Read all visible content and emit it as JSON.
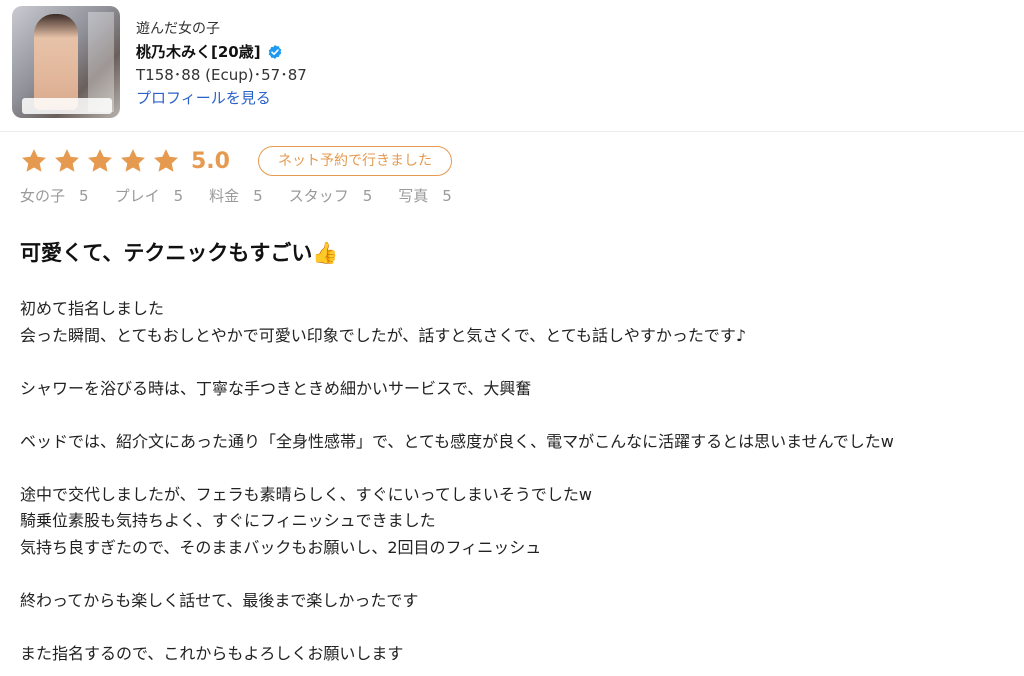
{
  "girl": {
    "caption": "遊んだ女の子",
    "name": "桃乃木みく[20歳]",
    "verified_icon": "verified-check-icon",
    "specs": "T158･88 (Ecup)･57･87",
    "profile_link": "プロフィールを見る",
    "thumbnail_icon": "profile-photo"
  },
  "rating": {
    "stars": 5,
    "score": "5.0",
    "booking_badge": "ネット予約で行きました",
    "star_color": "#e59a4f",
    "subscores": [
      {
        "label": "女の子",
        "value": "5"
      },
      {
        "label": "プレイ",
        "value": "5"
      },
      {
        "label": "料金",
        "value": "5"
      },
      {
        "label": "スタッフ",
        "value": "5"
      },
      {
        "label": "写真",
        "value": "5"
      }
    ]
  },
  "review": {
    "title": "可愛くて、テクニックもすごい👍",
    "paragraphs": [
      [
        "初めて指名しました",
        "会った瞬間、とてもおしとやかで可愛い印象でしたが、話すと気さくで、とても話しやすかったです♪"
      ],
      [
        "シャワーを浴びる時は、丁寧な手つきときめ細かいサービスで、大興奮"
      ],
      [
        "ベッドでは、紹介文にあった通り「全身性感帯」で、とても感度が良く、電マがこんなに活躍するとは思いませんでしたw"
      ],
      [
        "途中で交代しましたが、フェラも素晴らしく、すぐにいってしまいそうでしたw",
        "騎乗位素股も気持ちよく、すぐにフィニッシュできました",
        "気持ち良すぎたので、そのままバックもお願いし、2回目のフィニッシュ"
      ],
      [
        "終わってからも楽しく話せて、最後まで楽しかったです"
      ],
      [
        "また指名するので、これからもよろしくお願いします"
      ]
    ]
  }
}
